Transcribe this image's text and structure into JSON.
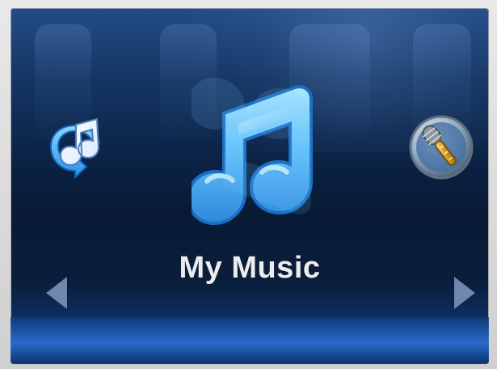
{
  "screen": {
    "title": "My Music"
  },
  "icons": {
    "left": "music-sync-icon",
    "center": "music-note-icon",
    "right": "microphone-icon",
    "nav_left": "left-arrow-icon",
    "nav_right": "right-arrow-icon"
  },
  "colors": {
    "background_top": "#173a6d",
    "background_mid": "#081a34",
    "background_bottom": "#2a6fd1",
    "title_text": "#ececec",
    "nav_arrow": "#6d87ad",
    "icon_blue": "#5ab7f4",
    "icon_gold": "#d8a12e"
  }
}
